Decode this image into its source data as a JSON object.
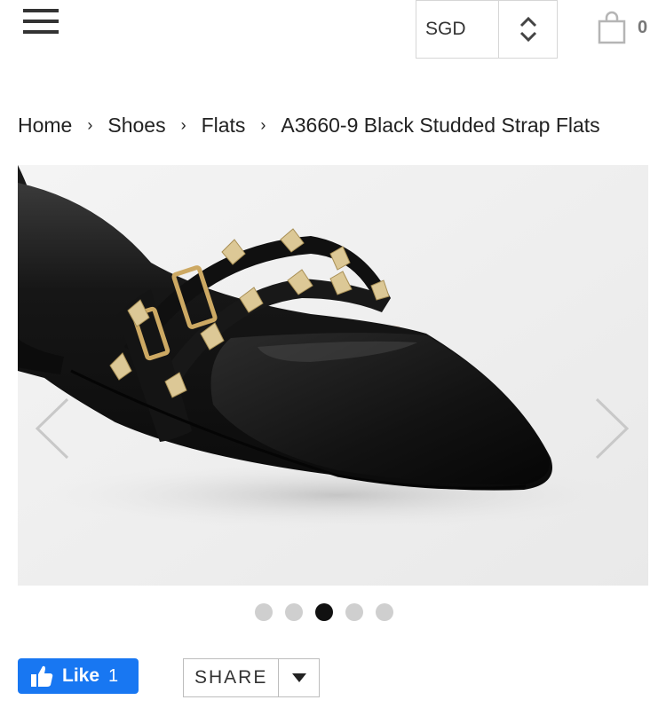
{
  "header": {
    "menu_icon": "hamburger-menu-icon",
    "currency": {
      "selected": "SGD",
      "icon": "up-down-chevron-icon"
    },
    "cart": {
      "icon": "shopping-bag-icon",
      "count": "0"
    }
  },
  "breadcrumb": {
    "items": [
      "Home",
      "Shoes",
      "Flats",
      "A3660-9 Black Studded Strap Flats"
    ],
    "separator": "›"
  },
  "gallery": {
    "image": "black pointed-toe leather flat with gold studded straps and buckle",
    "prev_icon": "chevron-left-icon",
    "next_icon": "chevron-right-icon",
    "slide_count": 5,
    "active_slide": 3
  },
  "social": {
    "like_label": "Like",
    "like_count": "1",
    "share_label": "SHARE"
  },
  "colors": {
    "facebook_blue": "#1877f2",
    "shoe_black": "#141414",
    "stud_gold": "#d8c38a",
    "dot_active": "#111111",
    "dot_inactive": "#cfcfcf"
  }
}
